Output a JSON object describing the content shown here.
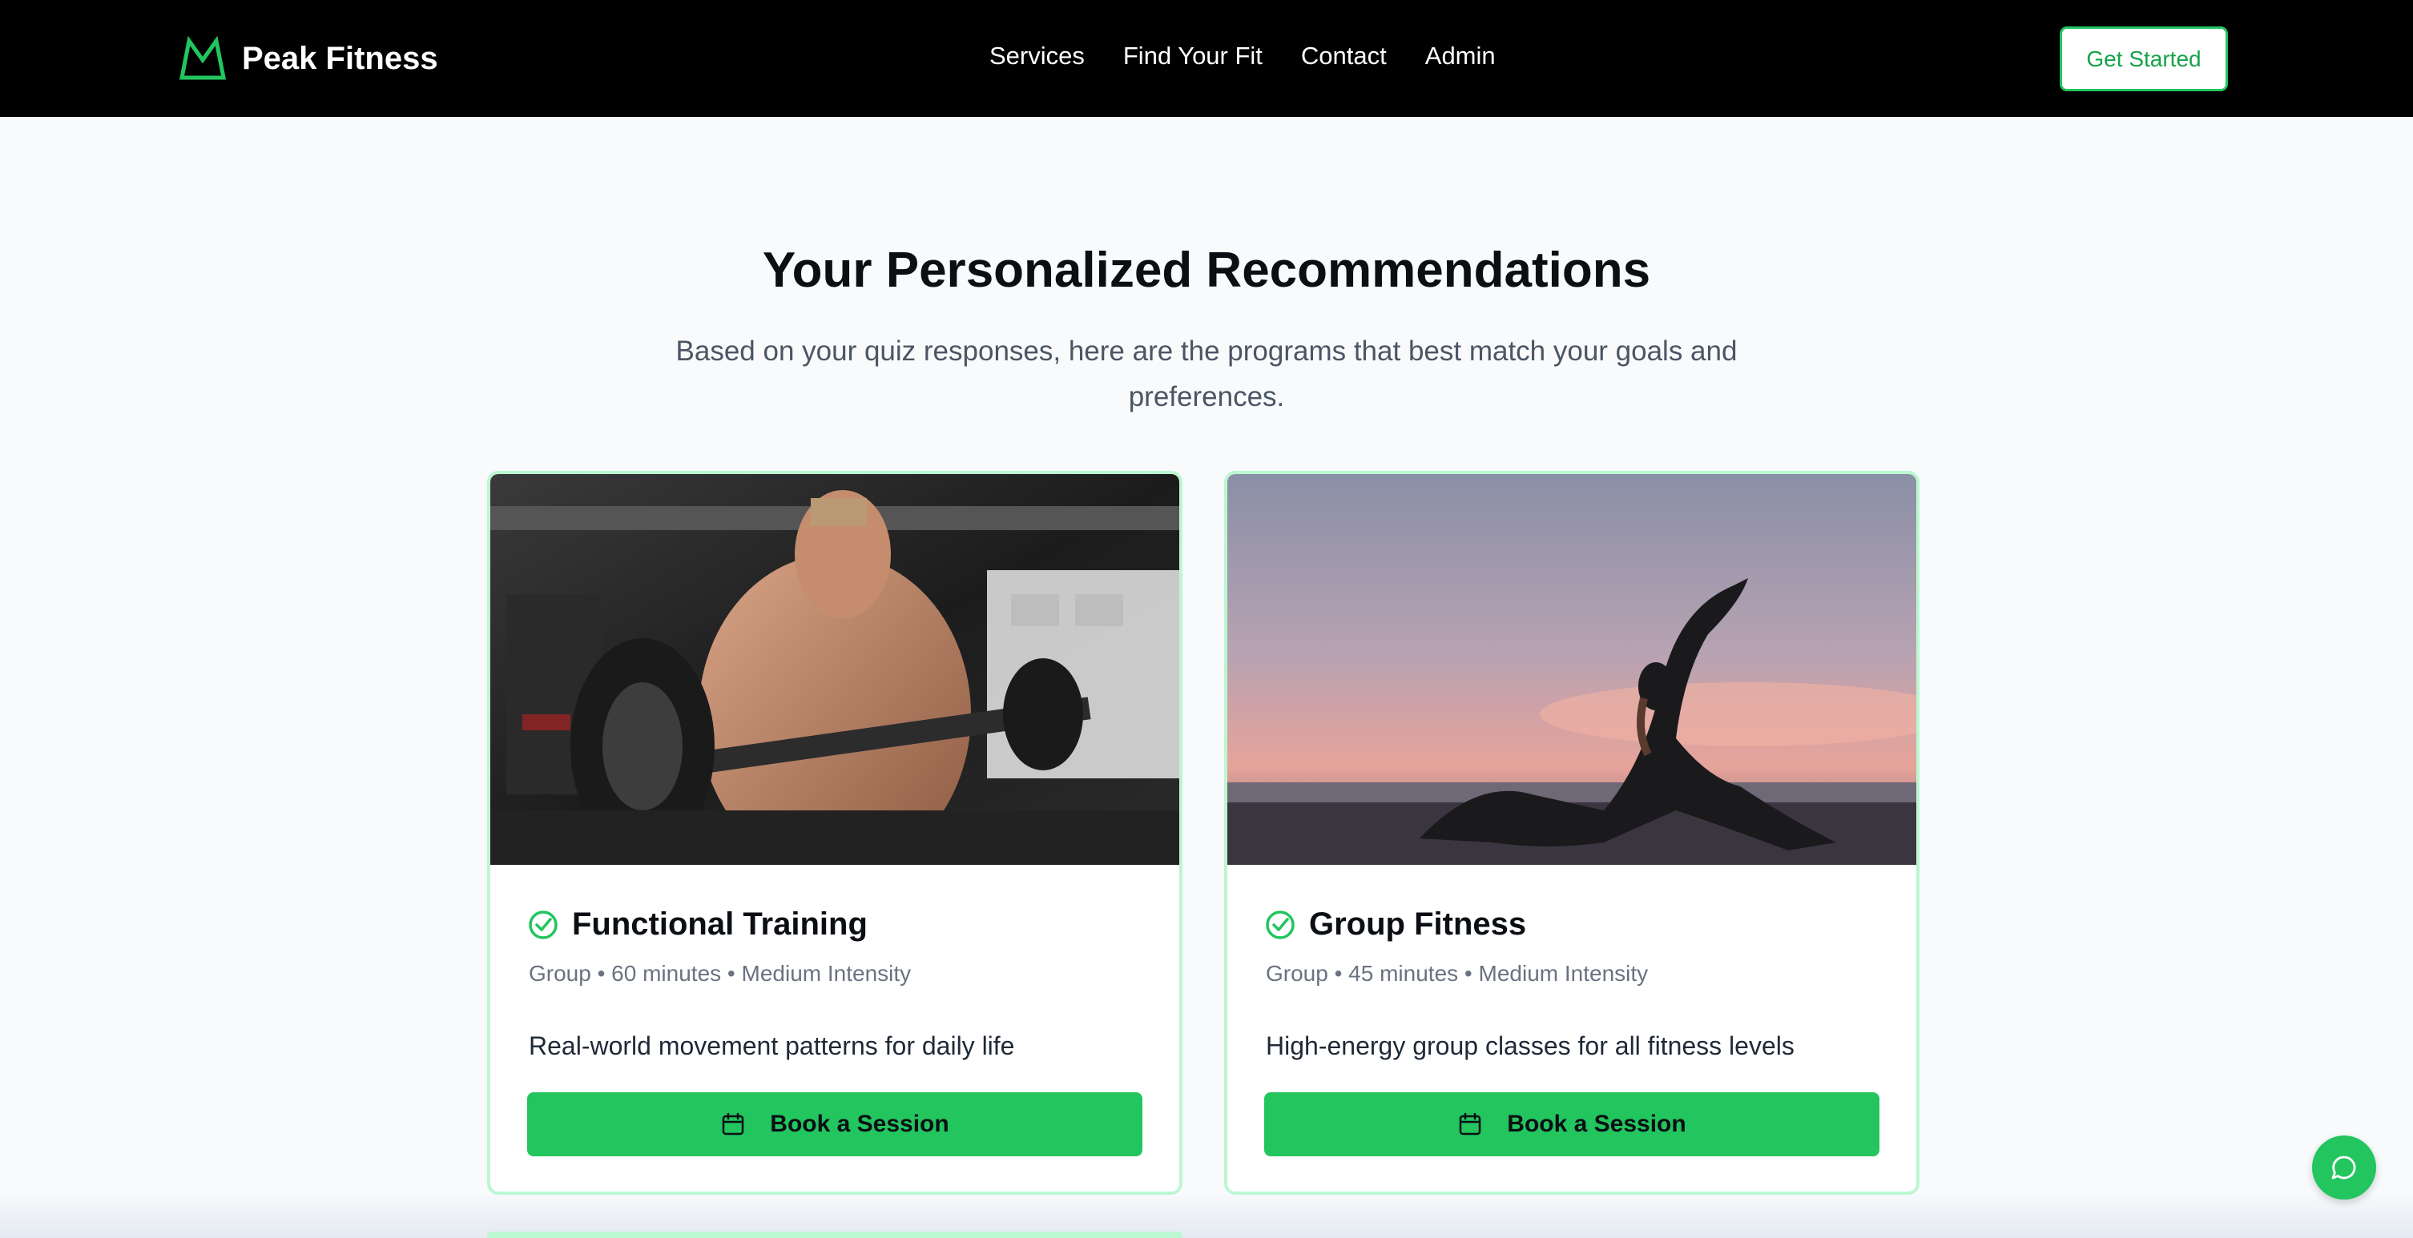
{
  "header": {
    "brand_name": "Peak Fitness",
    "logo_icon": "mountain-icon",
    "nav": [
      {
        "label": "Services"
      },
      {
        "label": "Find Your Fit"
      },
      {
        "label": "Contact"
      },
      {
        "label": "Admin"
      }
    ],
    "cta_label": "Get Started"
  },
  "main": {
    "title": "Your Personalized Recommendations",
    "subtitle": "Based on your quiz responses, here are the programs that best match your goals and preferences.",
    "cards": [
      {
        "title": "Functional Training",
        "meta": "Group • 60 minutes • Medium Intensity",
        "description": "Real-world movement patterns for daily life",
        "button_label": "Book a Session",
        "image": "gym-weightlifter-photo"
      },
      {
        "title": "Group Fitness",
        "meta": "Group • 45 minutes • Medium Intensity",
        "description": "High-energy group classes for all fitness levels",
        "button_label": "Book a Session",
        "image": "sunset-yoga-photo"
      }
    ]
  },
  "chat": {
    "icon": "chat-bubble-icon"
  },
  "colors": {
    "accent": "#22c55e",
    "accent_dark": "#16a34a",
    "card_border": "#bbf7d0",
    "navbar_bg": "#000000",
    "page_bg": "#f8fafc"
  }
}
